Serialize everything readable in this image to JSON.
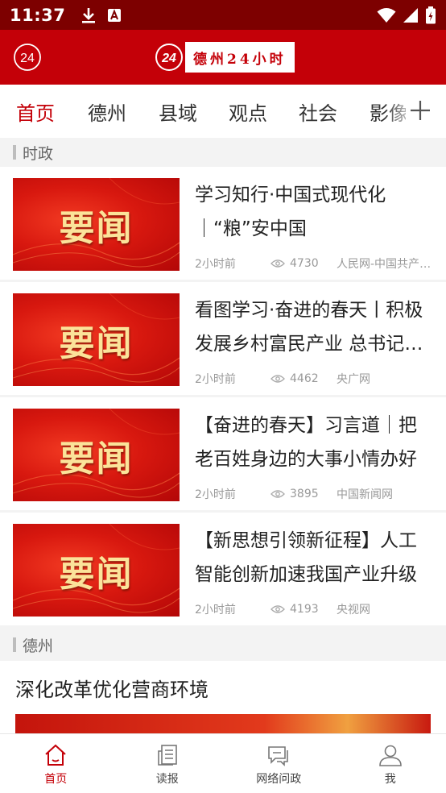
{
  "status_bar": {
    "time": "11:37",
    "download_icon": "download-icon",
    "a_icon": "a-letter-icon"
  },
  "header": {
    "small_logo": "24",
    "brand_number": "24",
    "brand_text": "德州24小时"
  },
  "tabs": [
    "首页",
    "德州",
    "县域",
    "观点",
    "社会",
    "影像"
  ],
  "sections": {
    "politics": "时政",
    "dezhou": "德州"
  },
  "thumb_text": "要闻",
  "news": [
    {
      "title": "学习知行·中国式现代化｜“粮”安中国",
      "time": "2小时前",
      "views": "4730",
      "source": "人民网-中国共产党新闻网"
    },
    {
      "title": "看图学习·奋进的春天丨积极发展乡村富民产业 总书记这样强调",
      "time": "2小时前",
      "views": "4462",
      "source": "央广网"
    },
    {
      "title": "【奋进的春天】习言道｜把老百姓身边的大事小情办好",
      "time": "2小时前",
      "views": "3895",
      "source": "中国新闻网"
    },
    {
      "title": "【新思想引领新征程】人工智能创新加速我国产业升级",
      "time": "2小时前",
      "views": "4193",
      "source": "央视网"
    }
  ],
  "featured": {
    "title": "深化改革优化营商环境"
  },
  "bottom_nav": [
    {
      "label": "首页",
      "icon": "home-icon"
    },
    {
      "label": "读报",
      "icon": "newspaper-icon"
    },
    {
      "label": "网络问政",
      "icon": "chat-icon"
    },
    {
      "label": "我",
      "icon": "user-icon"
    }
  ],
  "colors": {
    "accent": "#c40008",
    "statusbar": "#7d0000",
    "thumb_text": "#fbe39a"
  }
}
